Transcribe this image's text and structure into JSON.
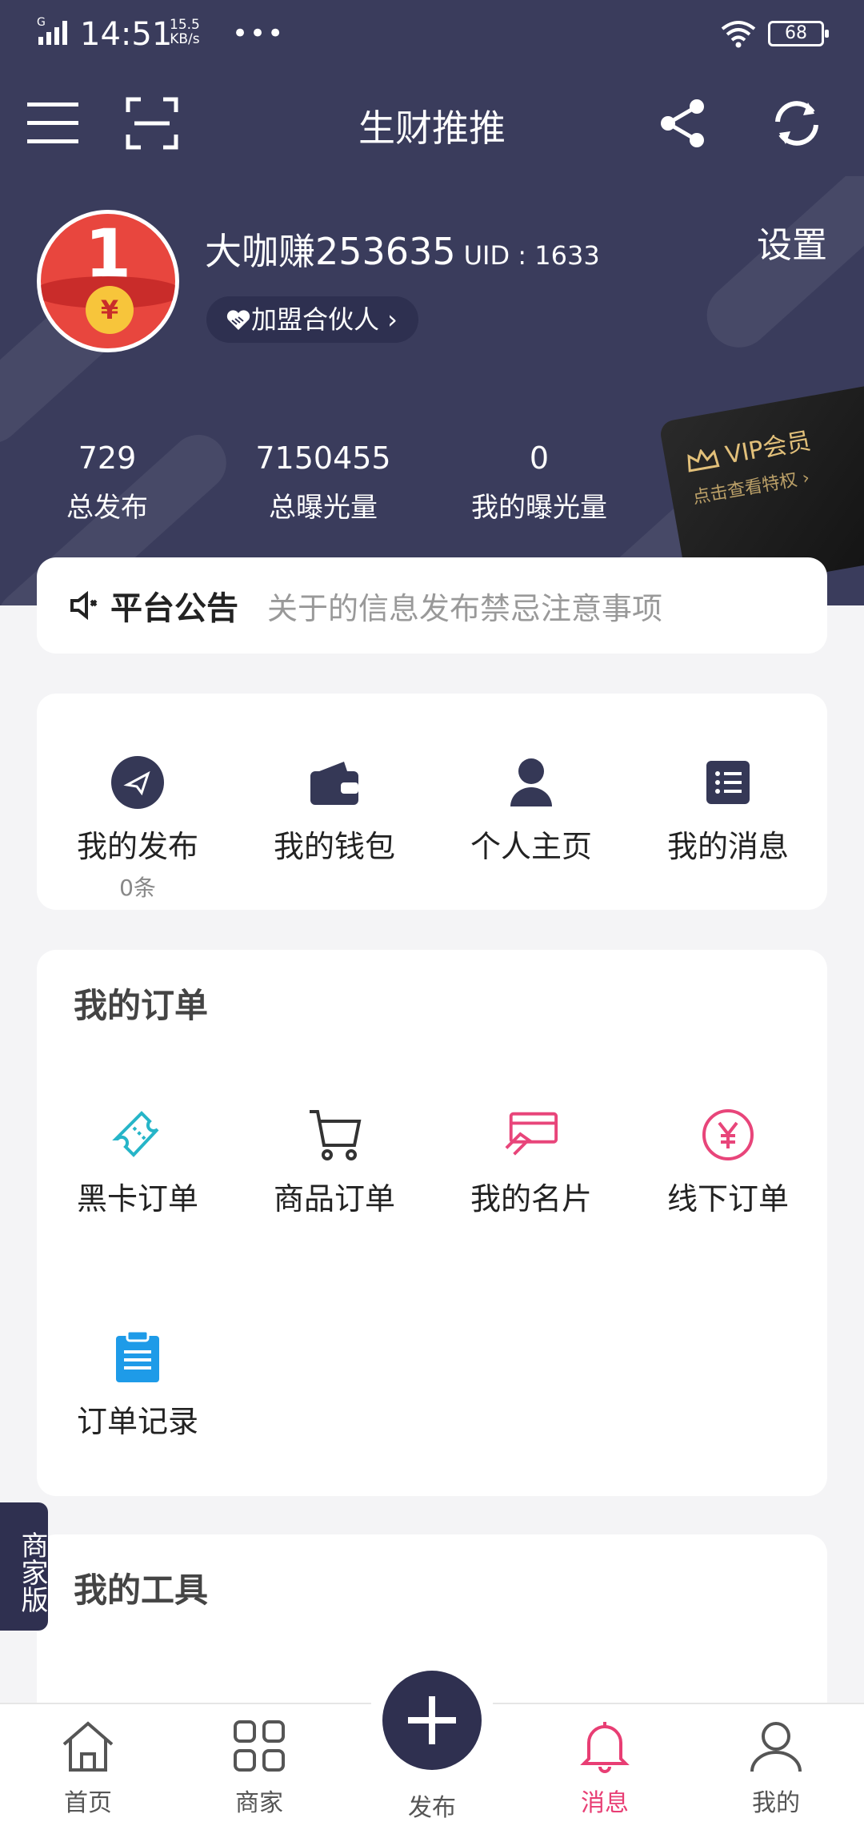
{
  "status_bar": {
    "time": "14:51",
    "speed_top": "15.5",
    "speed_bottom": "KB/s",
    "network": "G",
    "dots": "•••",
    "battery": "68"
  },
  "nav": {
    "title": "生财推推"
  },
  "profile": {
    "username": "大咖赚253635",
    "uid": "UID : 1633",
    "partner_label": "加盟合伙人 ›",
    "settings_label": "设置",
    "avatar_number": "1",
    "avatar_coin": "¥"
  },
  "stats": [
    {
      "value": "729",
      "label": "总发布"
    },
    {
      "value": "7150455",
      "label": "总曝光量"
    },
    {
      "value": "0",
      "label": "我的曝光量"
    }
  ],
  "vip_card": {
    "title": "VIP会员",
    "subtitle": "点击查看特权 ›"
  },
  "notice": {
    "label": "平台公告",
    "text": "关于的信息发布禁忌注意事项"
  },
  "quick_actions": [
    {
      "label": "我的发布",
      "sub": "0条",
      "icon": "paper-plane-icon"
    },
    {
      "label": "我的钱包",
      "icon": "wallet-icon"
    },
    {
      "label": "个人主页",
      "icon": "person-icon"
    },
    {
      "label": "我的消息",
      "icon": "message-list-icon"
    }
  ],
  "orders": {
    "title": "我的订单",
    "items": [
      {
        "label": "黑卡订单",
        "icon": "ticket-icon",
        "color": "#26b5c8"
      },
      {
        "label": "商品订单",
        "icon": "cart-icon",
        "color": "#333333"
      },
      {
        "label": "我的名片",
        "icon": "card-icon",
        "color": "#e8457a"
      },
      {
        "label": "线下订单",
        "icon": "yen-circle-icon",
        "color": "#e8457a"
      },
      {
        "label": "订单记录",
        "icon": "clipboard-icon",
        "color": "#1e9be8"
      }
    ]
  },
  "tools": {
    "title": "我的工具"
  },
  "merchant_tab": "商家版",
  "tabbar": [
    {
      "label": "首页",
      "icon": "home-icon"
    },
    {
      "label": "商家",
      "icon": "grid-icon"
    },
    {
      "label": "发布",
      "icon": "plus-icon"
    },
    {
      "label": "消息",
      "icon": "bell-icon",
      "active": true
    },
    {
      "label": "我的",
      "icon": "user-icon"
    }
  ],
  "colors": {
    "header": "#3a3c5c",
    "accent": "#e83e74",
    "background": "#f4f4f6"
  }
}
